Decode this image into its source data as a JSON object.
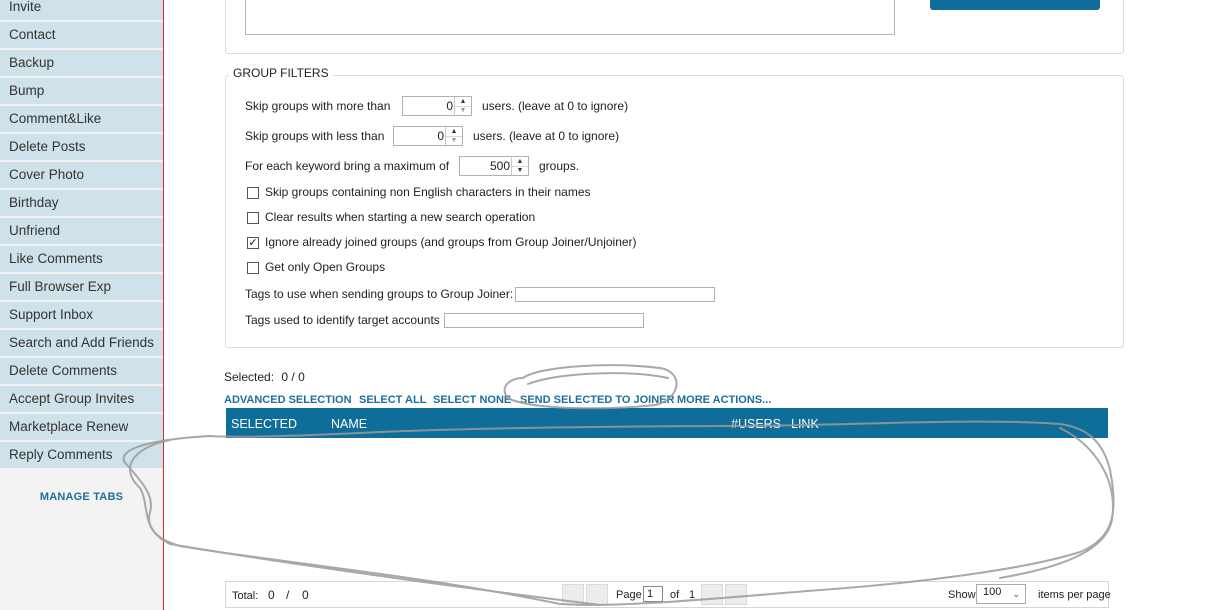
{
  "sidebar": {
    "items": [
      {
        "label": "Invite"
      },
      {
        "label": "Contact"
      },
      {
        "label": "Backup"
      },
      {
        "label": "Bump"
      },
      {
        "label": "Comment&Like"
      },
      {
        "label": "Delete Posts"
      },
      {
        "label": "Cover Photo"
      },
      {
        "label": "Birthday"
      },
      {
        "label": "Unfriend"
      },
      {
        "label": "Like Comments"
      },
      {
        "label": "Full Browser Exp"
      },
      {
        "label": "Support Inbox"
      },
      {
        "label": "Search and Add Friends"
      },
      {
        "label": "Delete Comments"
      },
      {
        "label": "Accept Group Invites"
      },
      {
        "label": "Marketplace Renew"
      },
      {
        "label": "Reply Comments"
      }
    ],
    "manage_tabs": "MANAGE TABS"
  },
  "filters": {
    "legend": "GROUP FILTERS",
    "more_than": {
      "label": "Skip groups with more than",
      "value": "0",
      "suffix": "users. (leave at 0 to ignore)"
    },
    "less_than": {
      "label": "Skip groups with less than",
      "value": "0",
      "suffix": "users. (leave at 0 to ignore)"
    },
    "max_per_keyword": {
      "label": "For each keyword bring a maximum of",
      "value": "500",
      "suffix": "groups."
    },
    "checkboxes": [
      {
        "label": "Skip groups containing non English characters in their names",
        "checked": false
      },
      {
        "label": "Clear results when starting a new search operation",
        "checked": false
      },
      {
        "label": "Ignore already joined groups (and groups from Group Joiner/Unjoiner)",
        "checked": true
      },
      {
        "label": "Get only Open Groups",
        "checked": false
      }
    ],
    "tags_joiner_label": "Tags to use when sending groups to Group Joiner:",
    "tags_joiner_value": "",
    "tags_identify_label": "Tags used to identify target accounts",
    "tags_identify_value": ""
  },
  "selection": {
    "label": "Selected:",
    "value": "0 / 0"
  },
  "actions": {
    "advanced": "ADVANCED SELECTION",
    "select_all": "SELECT ALL",
    "select_none": "SELECT NONE",
    "send_joiner": "SEND SELECTED TO JOINER",
    "more": "MORE ACTIONS..."
  },
  "table": {
    "columns": [
      "SELECTED",
      "NAME",
      "#USERS",
      "LINK"
    ],
    "rows": []
  },
  "pager": {
    "total_label": "Total:",
    "total_value": "0",
    "total_sep": "/",
    "total_max": "0",
    "page_label": "Page",
    "page_value": "1",
    "of_label": "of",
    "page_count": "1",
    "show_label": "Show",
    "show_value": "100",
    "items_per_page": "items per page"
  },
  "colors": {
    "accent": "#0f6e99",
    "sidebar_item": "#cfe1e9",
    "link": "#1e6e9c",
    "sidebar_border": "#d22a2a"
  }
}
